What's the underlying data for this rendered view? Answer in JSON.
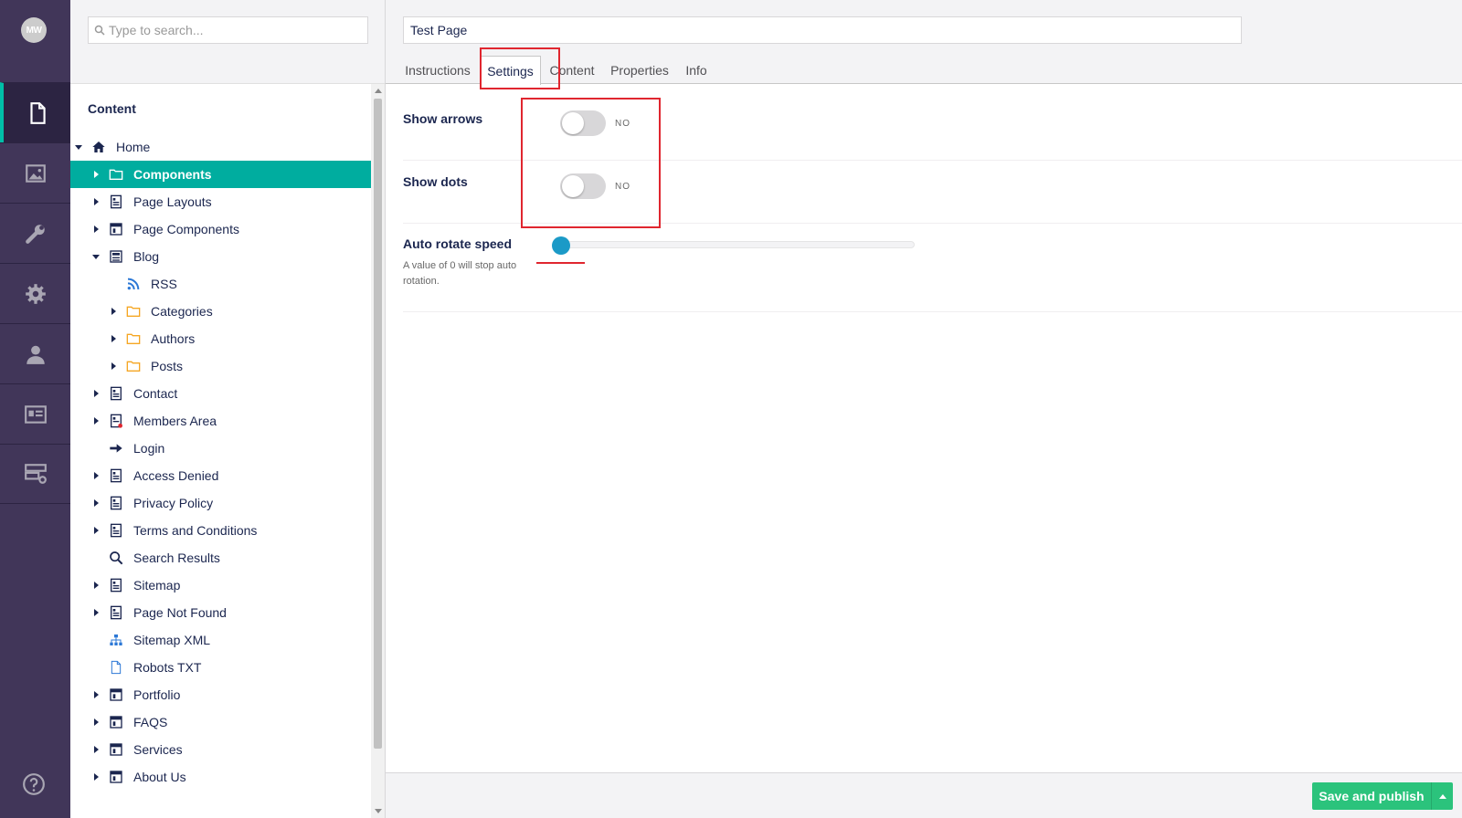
{
  "app": {
    "avatar_initials": "MW",
    "accent_color": "#00ad9f",
    "nav_sections": [
      {
        "icon": "document-icon",
        "active": true
      },
      {
        "icon": "image-icon",
        "active": false
      },
      {
        "icon": "wrench-icon",
        "active": false
      },
      {
        "icon": "gear-icon",
        "active": false
      },
      {
        "icon": "user-icon",
        "active": false
      },
      {
        "icon": "id-card-icon",
        "active": false
      },
      {
        "icon": "server-icon",
        "active": false
      }
    ],
    "help_icon": "question-circle-icon"
  },
  "tree": {
    "search_placeholder": "Type to search...",
    "title": "Content",
    "items": [
      {
        "label": "Home",
        "icon": "home-icon",
        "caret": "down",
        "depth": 0
      },
      {
        "label": "Components",
        "icon": "folder-icon",
        "caret": "right",
        "depth": 1,
        "selected": true
      },
      {
        "label": "Page Layouts",
        "icon": "page-icon",
        "caret": "right",
        "depth": 1
      },
      {
        "label": "Page Components",
        "icon": "layout-icon",
        "caret": "right",
        "depth": 1
      },
      {
        "label": "Blog",
        "icon": "newspaper-icon",
        "caret": "down",
        "depth": 1
      },
      {
        "label": "RSS",
        "icon": "rss-icon",
        "caret": "",
        "depth": 2
      },
      {
        "label": "Categories",
        "icon": "folder-icon",
        "caret": "right",
        "depth": 2
      },
      {
        "label": "Authors",
        "icon": "folder-icon",
        "caret": "right",
        "depth": 2
      },
      {
        "label": "Posts",
        "icon": "folder-icon",
        "caret": "right",
        "depth": 2
      },
      {
        "label": "Contact",
        "icon": "page-icon",
        "caret": "right",
        "depth": 1
      },
      {
        "label": "Members Area",
        "icon": "protected-page-icon",
        "caret": "right",
        "depth": 1
      },
      {
        "label": "Login",
        "icon": "arrow-right-icon",
        "caret": "",
        "depth": 1
      },
      {
        "label": "Access Denied",
        "icon": "page-icon",
        "caret": "right",
        "depth": 1
      },
      {
        "label": "Privacy Policy",
        "icon": "page-icon",
        "caret": "right",
        "depth": 1
      },
      {
        "label": "Terms and Conditions",
        "icon": "page-icon",
        "caret": "right",
        "depth": 1
      },
      {
        "label": "Search Results",
        "icon": "search-icon",
        "caret": "",
        "depth": 1
      },
      {
        "label": "Sitemap",
        "icon": "page-icon",
        "caret": "right",
        "depth": 1
      },
      {
        "label": "Page Not Found",
        "icon": "page-icon",
        "caret": "right",
        "depth": 1
      },
      {
        "label": "Sitemap XML",
        "icon": "sitemap-icon",
        "caret": "",
        "depth": 1
      },
      {
        "label": "Robots TXT",
        "icon": "file-icon",
        "caret": "",
        "depth": 1
      },
      {
        "label": "Portfolio",
        "icon": "layout-icon",
        "caret": "right",
        "depth": 1
      },
      {
        "label": "FAQS",
        "icon": "layout-icon",
        "caret": "right",
        "depth": 1
      },
      {
        "label": "Services",
        "icon": "layout-icon",
        "caret": "right",
        "depth": 1
      },
      {
        "label": "About Us",
        "icon": "layout-icon",
        "caret": "right",
        "depth": 1
      }
    ]
  },
  "editor": {
    "page_name": "Test Page",
    "tabs": [
      {
        "label": "Instructions"
      },
      {
        "label": "Settings",
        "active": true
      },
      {
        "label": "Content"
      },
      {
        "label": "Properties"
      },
      {
        "label": "Info"
      }
    ],
    "properties": {
      "show_arrows": {
        "label": "Show arrows",
        "state_text": "NO",
        "value": false
      },
      "show_dots": {
        "label": "Show dots",
        "state_text": "NO",
        "value": false
      },
      "auto_rotate": {
        "label": "Auto rotate speed",
        "description": "A value of 0 will stop auto rotation.",
        "value": 0
      }
    },
    "save_button": "Save and publish",
    "save_color": "#2bc37c"
  }
}
